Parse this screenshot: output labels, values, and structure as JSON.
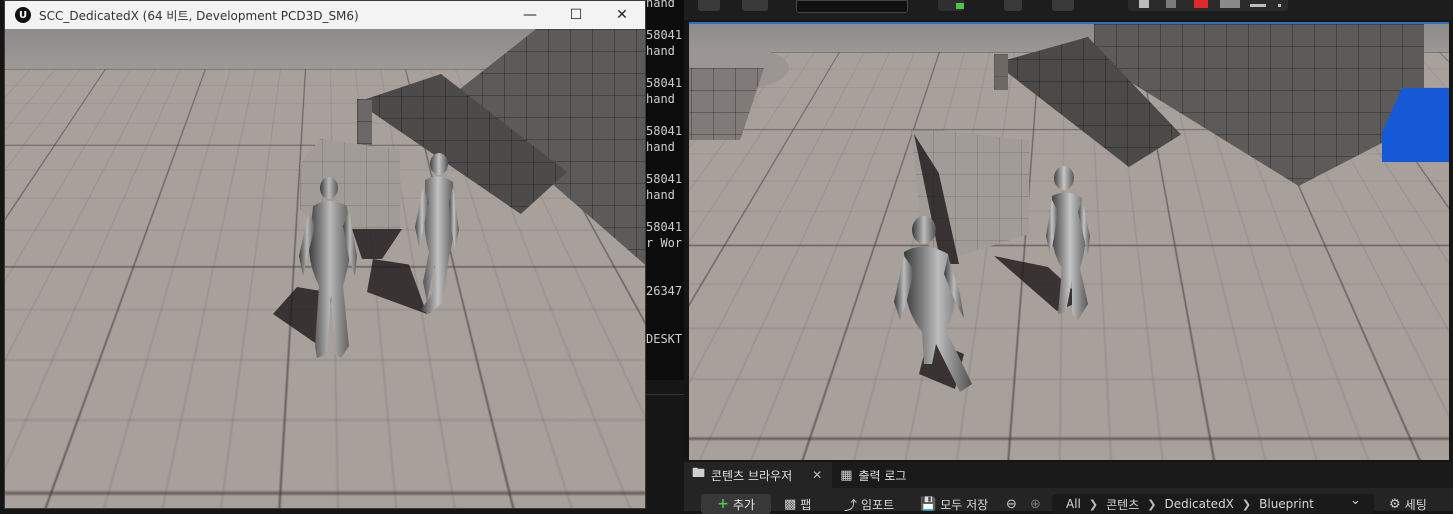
{
  "game_window": {
    "title": "SCC_DedicatedX (64 비트, Development PCD3D_SM6)",
    "logo_glyph": "U",
    "minimize_glyph": "—",
    "maximize_glyph": "☐",
    "close_glyph": "✕"
  },
  "console": {
    "lines": [
      "hand",
      "58041",
      "hand",
      "58041",
      "hand",
      "58041",
      "hand",
      "58041",
      "hand",
      "58041",
      "r Wor",
      "26347",
      "DESKT"
    ]
  },
  "content_browser": {
    "tabs": [
      {
        "label": "콘텐츠 브라우저",
        "icon": "folder-icon",
        "close": "✕"
      },
      {
        "label": "출력 로그",
        "icon": "terminal-icon"
      }
    ],
    "add_label": "추가",
    "add_glyph": "+",
    "fab_label": "팹",
    "import_label": "임포트",
    "save_all_label": "모두 저장",
    "breadcrumb": [
      "All",
      "콘텐츠",
      "DedicatedX",
      "Blueprint"
    ],
    "breadcrumb_sep": "❯",
    "settings_label": "세팅",
    "settings_glyph": "⚙",
    "back_glyph": "⊖",
    "forward_glyph": "⊕",
    "dropdown_glyph": "⌄"
  },
  "colors": {
    "viewport_border": "#2a6fc9",
    "blue_cube": "#1559d6",
    "add_plus": "#4fc24f",
    "record_button": "#e02a2a"
  }
}
